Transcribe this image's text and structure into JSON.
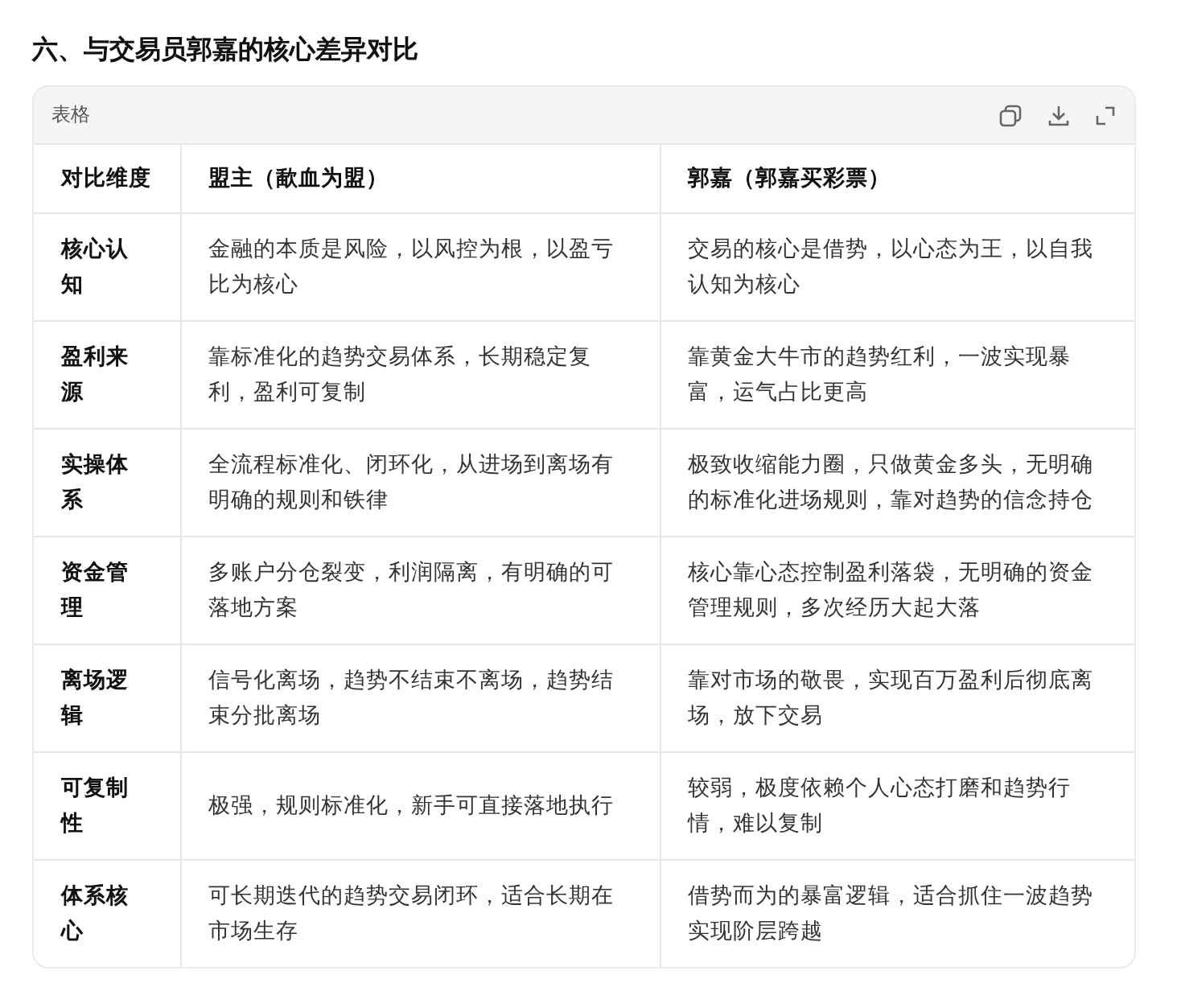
{
  "heading": "六、与交易员郭嘉的核心差异对比",
  "table_card": {
    "label": "表格",
    "columns": [
      "对比维度",
      "盟主（歃血为盟）",
      "郭嘉（郭嘉买彩票）"
    ],
    "rows": [
      [
        "核心认知",
        "金融的本质是风险，以风控为根，以盈亏比为核心",
        "交易的核心是借势，以心态为王，以自我认知为核心"
      ],
      [
        "盈利来源",
        "靠标准化的趋势交易体系，长期稳定复利，盈利可复制",
        "靠黄金大牛市的趋势红利，一波实现暴富，运气占比更高"
      ],
      [
        "实操体系",
        "全流程标准化、闭环化，从进场到离场有明确的规则和铁律",
        "极致收缩能力圈，只做黄金多头，无明确的标准化进场规则，靠对趋势的信念持仓"
      ],
      [
        "资金管理",
        "多账户分仓裂变，利润隔离，有明确的可落地方案",
        "核心靠心态控制盈利落袋，无明确的资金管理规则，多次经历大起大落"
      ],
      [
        "离场逻辑",
        "信号化离场，趋势不结束不离场，趋势结束分批离场",
        "靠对市场的敬畏，实现百万盈利后彻底离场，放下交易"
      ],
      [
        "可复制性",
        "极强，规则标准化，新手可直接落地执行",
        "较弱，极度依赖个人心态打磨和趋势行情，难以复制"
      ],
      [
        "体系核心",
        "可长期迭代的趋势交易闭环，适合长期在市场生存",
        "借势而为的暴富逻辑，适合抓住一波趋势实现阶层跨越"
      ]
    ]
  }
}
